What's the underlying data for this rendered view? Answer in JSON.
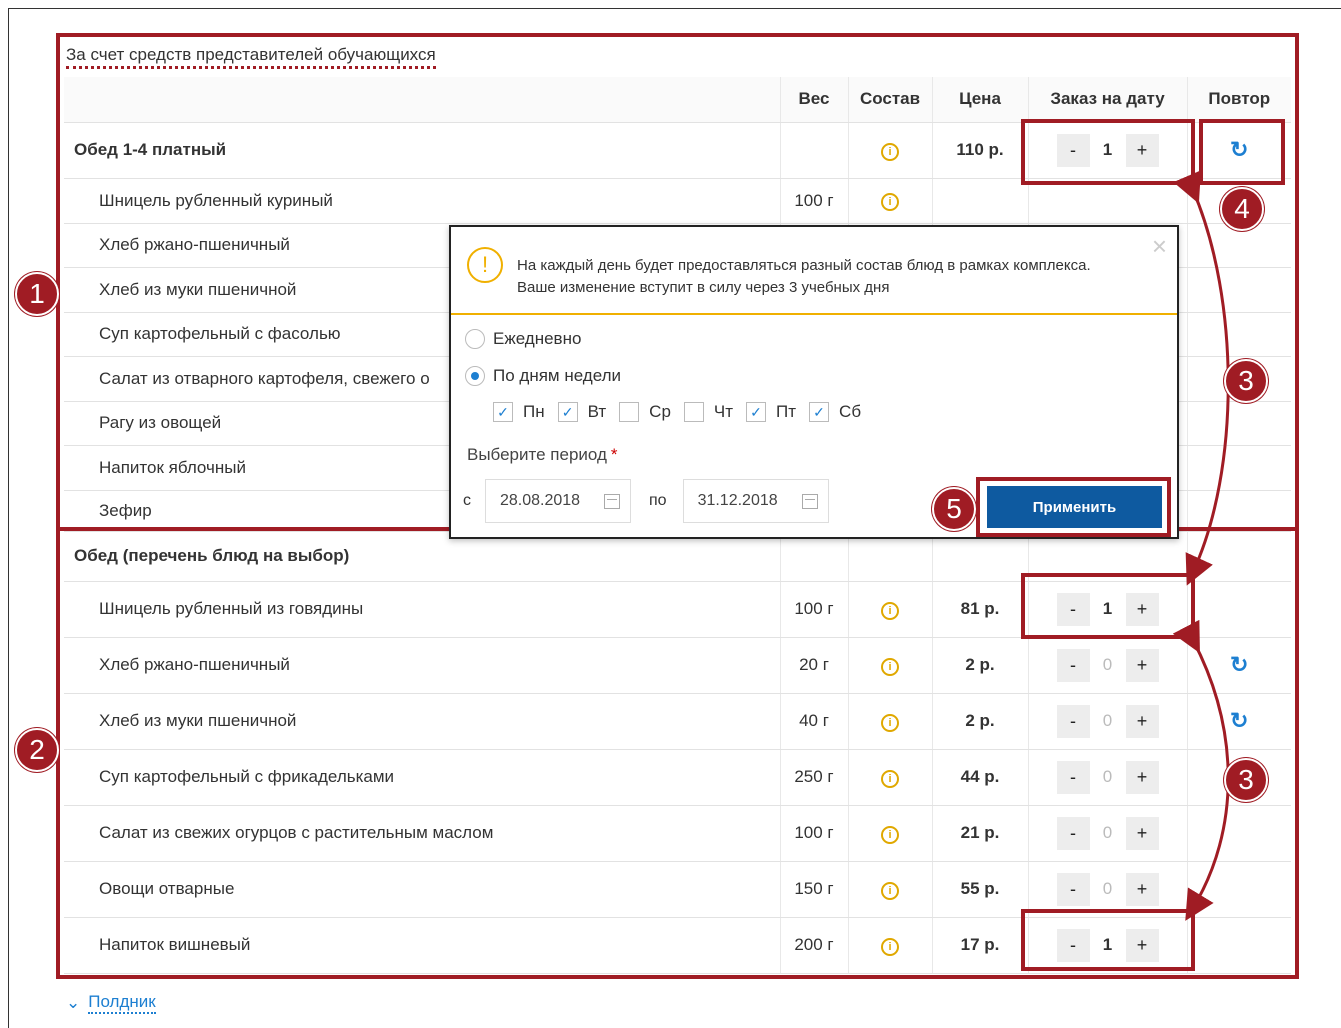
{
  "section_title": "За счет средств представителей обучающихся",
  "columns": {
    "weight": "Вес",
    "composition": "Состав",
    "price": "Цена",
    "order": "Заказ на дату",
    "repeat": "Повтор"
  },
  "group1": {
    "title": "Обед 1-4 платный",
    "price": "110 р.",
    "qty": "1",
    "items": [
      {
        "name": "Шницель рубленный куриный",
        "weight": "100 г"
      },
      {
        "name": "Хлеб ржано-пшеничный"
      },
      {
        "name": "Хлеб из муки пшеничной"
      },
      {
        "name": "Суп картофельный с фасолью"
      },
      {
        "name": "Салат из отварного картофеля, свежего о"
      },
      {
        "name": "Рагу из овощей"
      },
      {
        "name": "Напиток яблочный"
      },
      {
        "name": "Зефир"
      }
    ]
  },
  "group2": {
    "title": "Обед (перечень блюд на выбор)",
    "items": [
      {
        "name": "Шницель рубленный из говядины",
        "weight": "100 г",
        "price": "81 р.",
        "qty": "1"
      },
      {
        "name": "Хлеб ржано-пшеничный",
        "weight": "20 г",
        "price": "2 р.",
        "qty": "0"
      },
      {
        "name": "Хлеб из муки пшеничной",
        "weight": "40 г",
        "price": "2 р.",
        "qty": "0"
      },
      {
        "name": "Суп картофельный с фрикадельками",
        "weight": "250 г",
        "price": "44 р.",
        "qty": "0"
      },
      {
        "name": "Салат из свежих огурцов с растительным маслом",
        "weight": "100 г",
        "price": "21 р.",
        "qty": "0"
      },
      {
        "name": "Овощи отварные",
        "weight": "150 г",
        "price": "55 р.",
        "qty": "0"
      },
      {
        "name": "Напиток вишневый",
        "weight": "200 г",
        "price": "17 р.",
        "qty": "1"
      }
    ]
  },
  "stepper": {
    "minus": "-",
    "plus": "+"
  },
  "info_symbol": "i",
  "repeat_symbol": "↻",
  "popup": {
    "warn_symbol": "!",
    "close": "×",
    "warning_line1": "На каждый день будет предоставляться разный состав блюд в рамках комплекса.",
    "warning_line2": "Ваше изменение вступит в силу через 3 учебных дня",
    "option_daily": "Ежедневно",
    "option_weekdays": "По дням недели",
    "days": [
      {
        "label": "Пн",
        "checked": true
      },
      {
        "label": "Вт",
        "checked": true
      },
      {
        "label": "Ср",
        "checked": false
      },
      {
        "label": "Чт",
        "checked": false
      },
      {
        "label": "Пт",
        "checked": true
      },
      {
        "label": "Сб",
        "checked": true
      }
    ],
    "period_label": "Выберите период",
    "required_mark": "*",
    "from_label": "с",
    "from_date": "28.08.2018",
    "to_label": "по",
    "to_date": "31.12.2018",
    "apply_label": "Применить"
  },
  "badges": [
    "1",
    "2",
    "3",
    "3",
    "4",
    "5"
  ],
  "bottom_link": "Полдник",
  "colors": {
    "annotation": "#a01c24",
    "accent": "#1d7fd1",
    "warning": "#f0b000",
    "apply": "#0e5aa0"
  }
}
